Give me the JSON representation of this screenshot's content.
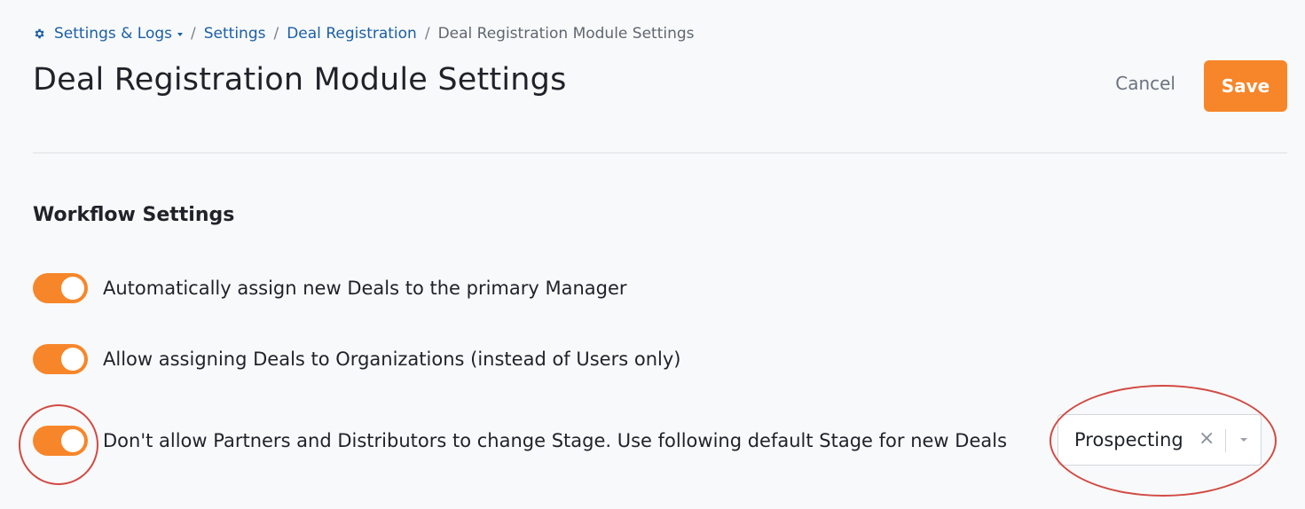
{
  "breadcrumb": {
    "root_label": "Settings & Logs",
    "root_icon": "gear-icon",
    "items": [
      "Settings",
      "Deal Registration"
    ],
    "current": "Deal Registration Module Settings",
    "separator": "/"
  },
  "header": {
    "title": "Deal Registration Module Settings",
    "cancel_label": "Cancel",
    "save_label": "Save"
  },
  "workflow": {
    "heading": "Workflow Settings",
    "settings": [
      {
        "label": "Automatically assign new Deals to the primary Manager",
        "enabled": true
      },
      {
        "label": "Allow assigning Deals to Organizations (instead of Users only)",
        "enabled": true
      },
      {
        "label": "Don't allow Partners and Distributors to change Stage. Use following default Stage for new Deals",
        "enabled": true
      }
    ],
    "default_stage": {
      "value": "Prospecting",
      "clear_glyph": "×"
    }
  },
  "colors": {
    "accent": "#f7862a",
    "link": "#1b5fa6",
    "annotation": "#d24a43",
    "background": "#f8f9fa"
  }
}
